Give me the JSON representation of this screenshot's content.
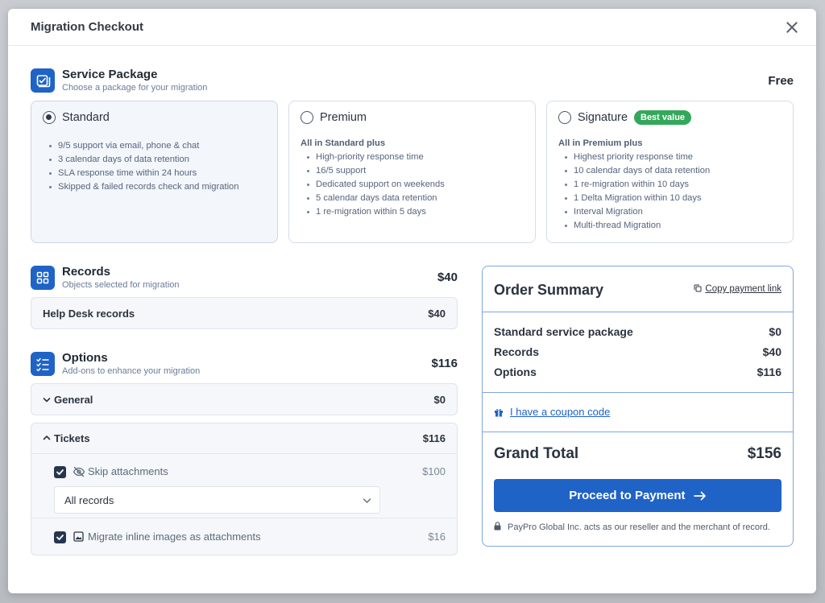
{
  "modal": {
    "title": "Migration Checkout"
  },
  "service_package": {
    "title": "Service Package",
    "subtitle": "Choose a package for your migration",
    "price": "Free",
    "packages": [
      {
        "name": "Standard",
        "selected": true,
        "lead": "",
        "features": [
          "9/5 support via email, phone & chat",
          "3 calendar days of data retention",
          "SLA response time within 24 hours",
          "Skipped & failed records check and migration"
        ]
      },
      {
        "name": "Premium",
        "selected": false,
        "lead": "All in Standard plus",
        "features": [
          "High-priority response time",
          "16/5 support",
          "Dedicated support on weekends",
          "5 calendar days data retention",
          "1 re-migration within 5 days"
        ]
      },
      {
        "name": "Signature",
        "selected": false,
        "badge": "Best value",
        "lead": "All in Premium plus",
        "features": [
          "Highest priority response time",
          "10 calendar days of data retention",
          "1 re-migration within 10 days",
          "1 Delta Migration within 10 days",
          "Interval Migration",
          "Multi-thread Migration"
        ]
      }
    ]
  },
  "records": {
    "title": "Records",
    "subtitle": "Objects selected for migration",
    "price": "$40",
    "items": [
      {
        "label": "Help Desk records",
        "price": "$40"
      }
    ]
  },
  "options": {
    "title": "Options",
    "subtitle": "Add-ons to enhance your migration",
    "price": "$116",
    "general": {
      "label": "General",
      "price": "$0",
      "expanded": false
    },
    "tickets": {
      "label": "Tickets",
      "price": "$116",
      "expanded": true,
      "items": [
        {
          "label": "Skip attachments",
          "price": "$100",
          "checked": true,
          "select_value": "All records"
        },
        {
          "label": "Migrate inline images as attachments",
          "price": "$16",
          "checked": true
        }
      ]
    }
  },
  "summary": {
    "title": "Order Summary",
    "copy_link": "Copy payment link",
    "lines": [
      {
        "label": "Standard service package",
        "value": "$0"
      },
      {
        "label": "Records",
        "value": "$40"
      },
      {
        "label": "Options",
        "value": "$116"
      }
    ],
    "coupon": "I have a coupon code",
    "grand_total_label": "Grand Total",
    "grand_total_value": "$156",
    "pay_button": "Proceed to Payment",
    "reseller_note": "PayPro Global Inc. acts as our reseller and the merchant of record."
  },
  "colors": {
    "accent": "#1f63c6",
    "badge": "#34a85a",
    "summary_border": "#7ea6dd",
    "checkbox": "#27364f"
  },
  "icons": [
    "close-icon",
    "package-icon",
    "grid-icon",
    "checklist-icon",
    "chevron-down-icon",
    "chevron-up-icon",
    "check-icon",
    "eye-off-icon",
    "image-icon",
    "copy-icon",
    "gift-icon",
    "arrow-right-icon",
    "lock-icon"
  ]
}
